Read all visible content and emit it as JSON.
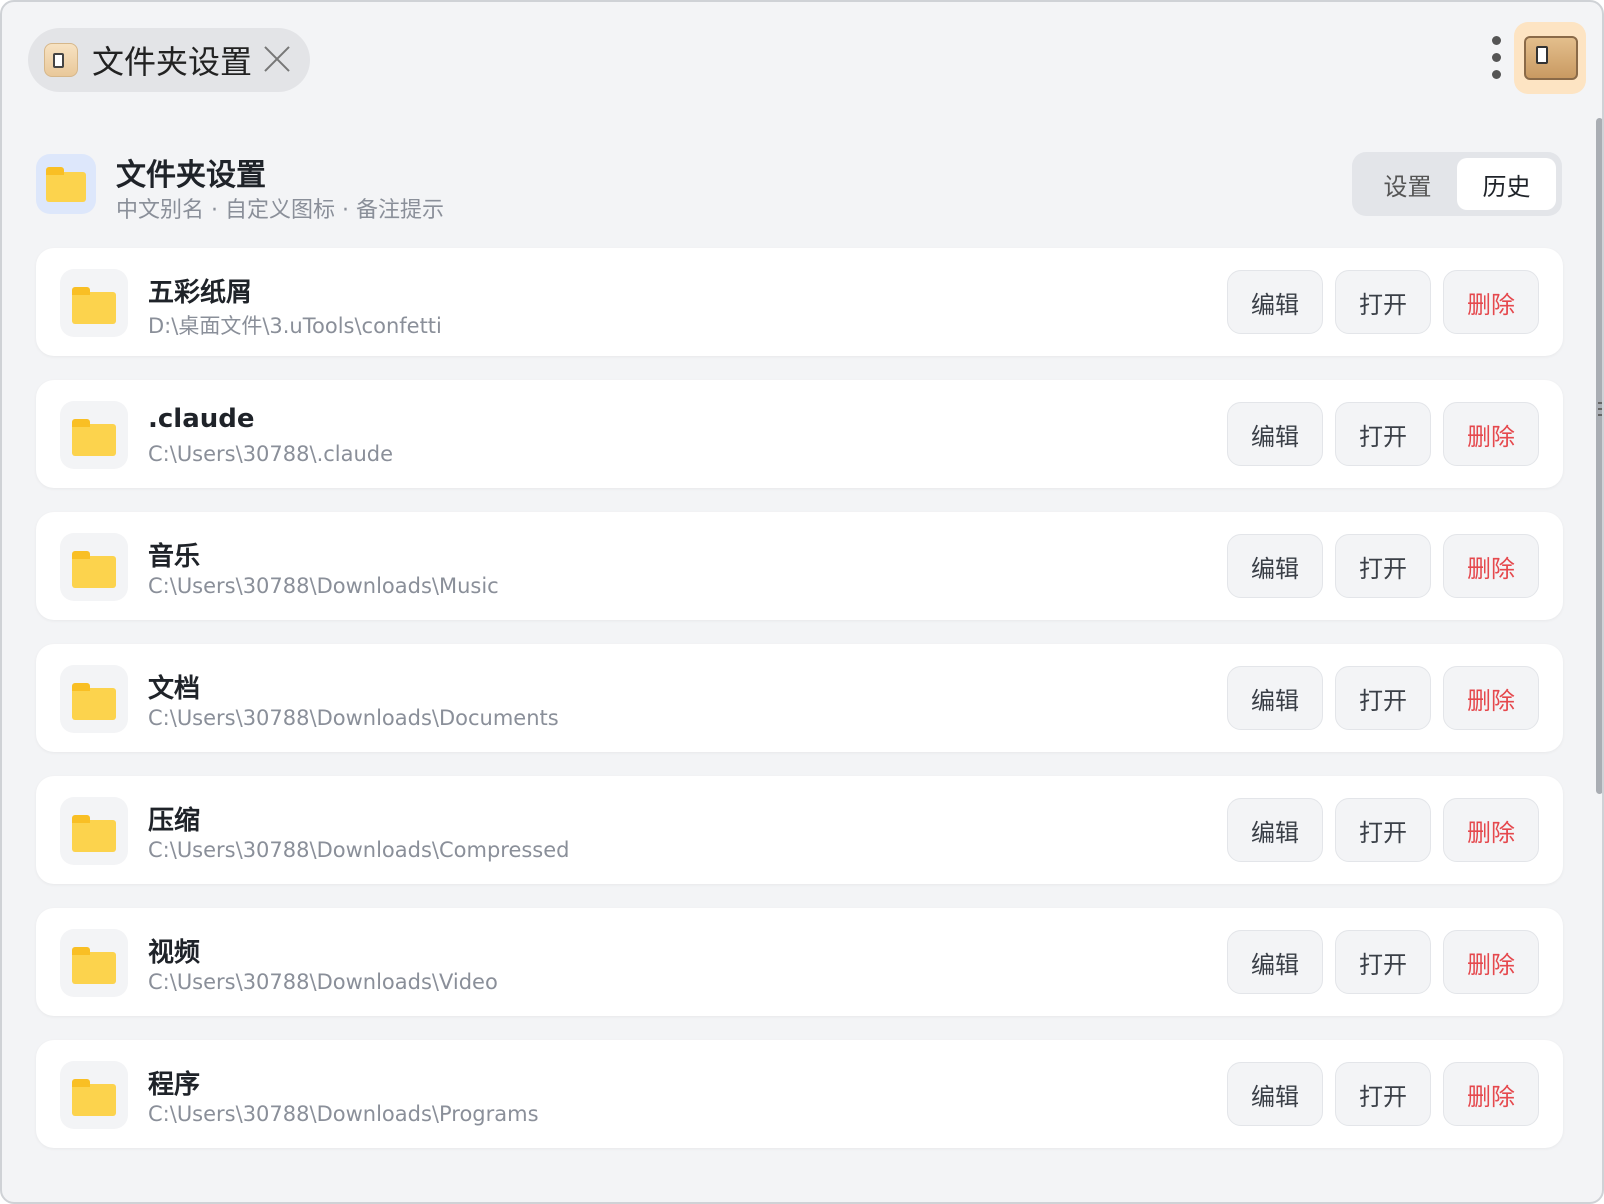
{
  "window": {
    "tab_title": "文件夹设置"
  },
  "header": {
    "title": "文件夹设置",
    "subtitle": "中文别名 · 自定义图标 · 备注提示",
    "segments": [
      {
        "label": "设置",
        "active": false
      },
      {
        "label": "历史",
        "active": true
      }
    ]
  },
  "actions": {
    "edit": "编辑",
    "open": "打开",
    "delete": "删除"
  },
  "folders": [
    {
      "name": "五彩纸屑",
      "path": "D:\\桌面文件\\3.uTools\\confetti"
    },
    {
      "name": ".claude",
      "path": "C:\\Users\\30788\\.claude"
    },
    {
      "name": "音乐",
      "path": "C:\\Users\\30788\\Downloads\\Music"
    },
    {
      "name": "文档",
      "path": "C:\\Users\\30788\\Downloads\\Documents"
    },
    {
      "name": "压缩",
      "path": "C:\\Users\\30788\\Downloads\\Compressed"
    },
    {
      "name": "视频",
      "path": "C:\\Users\\30788\\Downloads\\Video"
    },
    {
      "name": "程序",
      "path": "C:\\Users\\30788\\Downloads\\Programs"
    }
  ],
  "colors": {
    "background": "#f3f4f6",
    "card": "#ffffff",
    "folder": "#fcd34d",
    "danger": "#e5484d"
  }
}
